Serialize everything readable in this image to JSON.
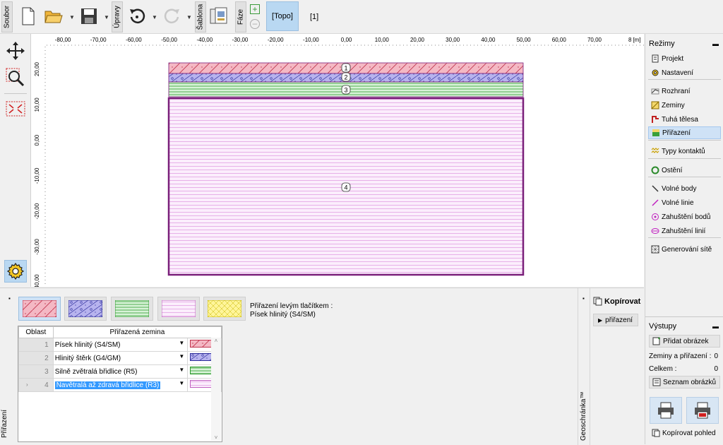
{
  "toolbar": {
    "soubor": "Soubor",
    "upravy": "Úpravy",
    "sablona": "Šablona",
    "faze": "Fáze",
    "topo": "[Topo]",
    "stage": "[1]"
  },
  "ruler": {
    "x_ticks": [
      "-80,00",
      "-70,00",
      "-60,00",
      "-50,00",
      "-40,00",
      "-30,00",
      "-20,00",
      "-10,00",
      "0,00",
      "10,00",
      "20,00",
      "30,00",
      "40,00",
      "50,00",
      "60,00",
      "70,00",
      "8"
    ],
    "x_unit": "[m]",
    "y_ticks": [
      "20,00",
      "10,00",
      "0,00",
      "-10,00",
      "-20,00",
      "-30,00",
      "-40,00"
    ]
  },
  "model": {
    "region_labels": [
      "1",
      "2",
      "3",
      "4"
    ]
  },
  "modes": {
    "title": "Režimy",
    "items": [
      {
        "label": "Projekt",
        "icon": "document-icon"
      },
      {
        "label": "Nastavení",
        "icon": "gear-icon"
      },
      {
        "label": "Rozhraní",
        "icon": "interface-icon"
      },
      {
        "label": "Zeminy",
        "icon": "soil-icon"
      },
      {
        "label": "Tuhá tělesa",
        "icon": "rigid-body-icon"
      },
      {
        "label": "Přiřazení",
        "icon": "assign-icon"
      },
      {
        "label": "Typy kontaktů",
        "icon": "contact-icon"
      },
      {
        "label": "Ostění",
        "icon": "lining-icon"
      },
      {
        "label": "Volné body",
        "icon": "point-icon"
      },
      {
        "label": "Volné linie",
        "icon": "line-icon"
      },
      {
        "label": "Zahuštění bodů",
        "icon": "point-refine-icon"
      },
      {
        "label": "Zahuštění linií",
        "icon": "line-refine-icon"
      },
      {
        "label": "Generování sítě",
        "icon": "mesh-icon"
      }
    ]
  },
  "outputs": {
    "title": "Výstupy",
    "add_image": "Přidat obrázek",
    "soils_label": "Zeminy a přiřazení :",
    "soils_value": "0",
    "total_label": "Celkem :",
    "total_value": "0",
    "list_images": "Seznam obrázků",
    "copy_view": "Kopírovat pohled"
  },
  "bottom": {
    "side_label": "Přiřazení",
    "hint_line1": "Přiřazení levým tlačítkem :",
    "hint_line2": "Písek hlinitý (S4/SM)",
    "table": {
      "col_region": "Oblast",
      "col_soil": "Přiřazená zemina",
      "rows": [
        {
          "num": "1",
          "soil": "Písek hlinitý (S4/SM)"
        },
        {
          "num": "2",
          "soil": "Hlinitý štěrk (G4/GM)"
        },
        {
          "num": "3",
          "soil": "Silně zvětralá břidlice (R5)"
        },
        {
          "num": "4",
          "soil": "Navětralá až zdravá břidlice (R3)"
        }
      ]
    },
    "geo_label": "Geoschránka™",
    "kopirovat": "Kopírovat",
    "prirazeni_btn": "přiřazení"
  },
  "colors": {
    "soil1": "#f4b8c4",
    "soil2": "#b7b3ee",
    "soil3": "#c6efc6",
    "soil4": "#f9e6fb",
    "soil5": "#fff59a",
    "boundary": "#7a1f7a",
    "accent": "#b9d8f2"
  }
}
